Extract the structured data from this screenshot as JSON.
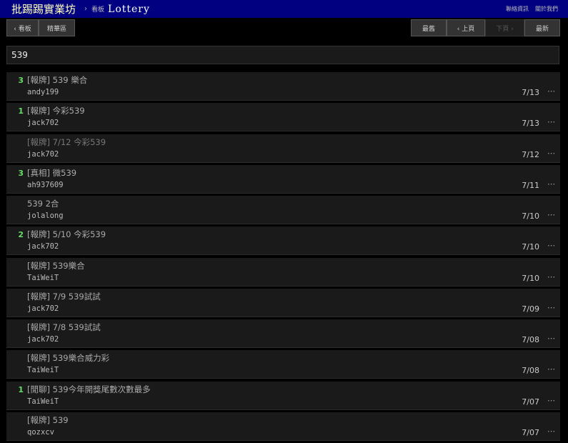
{
  "header": {
    "site_title": "批踢踢實業坊",
    "separator": "›",
    "crumb_label": "看板",
    "board_name": "Lottery",
    "links": [
      "聯絡資訊",
      "關於我們"
    ]
  },
  "toolbar": {
    "board_btn": "‹ 看板",
    "digest_btn": "精華區",
    "oldest_btn": "最舊",
    "prev_btn": "‹ 上頁",
    "next_btn": "下頁 ›",
    "newest_btn": "最新"
  },
  "search": {
    "value": "539"
  },
  "posts": [
    {
      "count": "3",
      "title": "[報牌] 539 樂合",
      "author": "andy199",
      "date": "7/13",
      "more": "⋯"
    },
    {
      "count": "1",
      "title": "[報牌] 今彩539",
      "author": "jack702",
      "date": "7/13",
      "more": "⋯"
    },
    {
      "count": "",
      "title": "[報牌] 7/12 今彩539",
      "author": "jack702",
      "date": "7/12",
      "more": "⋯"
    },
    {
      "count": "3",
      "title": "[真相] 微539",
      "author": "ah937609",
      "date": "7/11",
      "more": "⋯"
    },
    {
      "count": "",
      "title": "539 2合",
      "author": "jolalong",
      "date": "7/10",
      "more": "⋯"
    },
    {
      "count": "2",
      "title": "[報牌] 5/10 今彩539",
      "author": "jack702",
      "date": "7/10",
      "more": "⋯"
    },
    {
      "count": "",
      "title": "[報牌] 539樂合",
      "author": "TaiWeiT",
      "date": "7/10",
      "more": "⋯"
    },
    {
      "count": "",
      "title": "[報牌] 7/9 539試試",
      "author": "jack702",
      "date": "7/09",
      "more": "⋯"
    },
    {
      "count": "",
      "title": "[報牌] 7/8 539試試",
      "author": "jack702",
      "date": "7/08",
      "more": "⋯"
    },
    {
      "count": "",
      "title": "[報牌] 539樂合威力彩",
      "author": "TaiWeiT",
      "date": "7/08",
      "more": "⋯"
    },
    {
      "count": "1",
      "title": "[閒聊] 539今年開獎尾數次數最多",
      "author": "TaiWeiT",
      "date": "7/07",
      "more": "⋯"
    },
    {
      "count": "",
      "title": "[報牌] 539",
      "author": "qozxcv",
      "date": "7/07",
      "more": "⋯"
    }
  ]
}
